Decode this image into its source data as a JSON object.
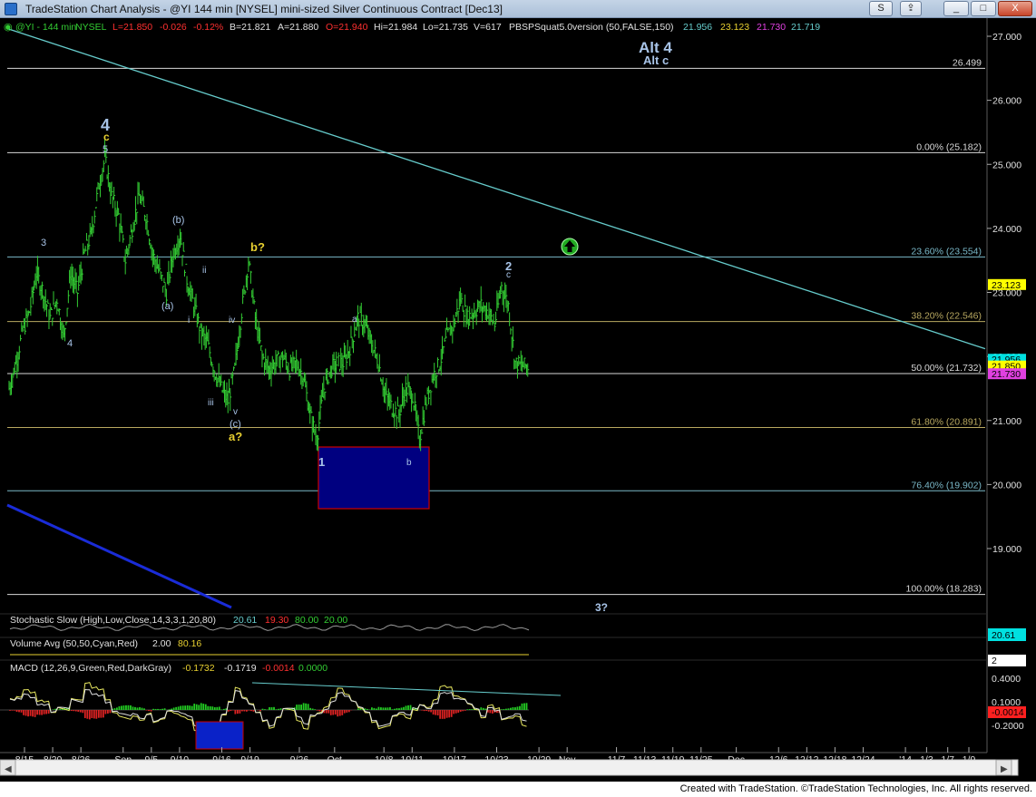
{
  "window": {
    "title": "TradeStation Chart Analysis - @YI 144 min [NYSEL] mini-sized Silver Continuous Contract [Dec13]",
    "buttons": {
      "symbol": "S",
      "minimize": "_",
      "maximize": "□",
      "close": "X"
    }
  },
  "colors": {
    "background": "#000000",
    "price_bars": "#33cc33",
    "trendline": "#66cccc",
    "fib_lines": "#c8c8c8",
    "fib_label": "#c8c8c8",
    "wave_label_white": "#a8c4e8",
    "wave_label_yellow": "#e8d030",
    "last_price_tag": "#ffff00",
    "box_fill": "#000080",
    "box_border": "#cc0000",
    "macd_line": "#e8e860",
    "stoch_line": "#999999"
  },
  "header": {
    "symbol": "@YI - 144 min",
    "exchange": "NYSEL",
    "last": "L=21.850",
    "change": "-0.026",
    "pct_change": "-0.12%",
    "bid": "B=21.821",
    "ask": "A=21.880",
    "open": "O=21.940",
    "high": "Hi=21.984",
    "low": "Lo=21.735",
    "volume": "V=617",
    "indicator_name": "PBSPSquat5.0version (50,FALSE,150)",
    "ind_v1": "21.956",
    "ind_v2": "23.123",
    "ind_v3": "21.730",
    "ind_v4": "21.719"
  },
  "annotations": {
    "alt4": "Alt 4",
    "altc": "Alt c",
    "wave4": "4",
    "wave4_c": "c",
    "wave4_5": "5",
    "w3": "3",
    "w4small": "4",
    "wb_paren": "(b)",
    "wa_paren": "(a)",
    "wii": "ii",
    "wi": "i",
    "wiv": "iv",
    "wiii": "iii",
    "wv": "v",
    "wc_paren": "(c)",
    "a_q": "a?",
    "b_q": "b?",
    "w1": "1",
    "wa": "a",
    "wb": "b",
    "w2": "2",
    "w2c": "c",
    "w3q": "3?"
  },
  "chart_data": {
    "type": "ohlc-bar",
    "symbol": "@YI",
    "interval": "144 min",
    "ylim": [
      18.0,
      27.2
    ],
    "price_axis_ticks": [
      "27.000",
      "26.000",
      "25.000",
      "24.000",
      "23.000",
      "22.000",
      "21.000",
      "20.000",
      "19.000"
    ],
    "price_axis_values": [
      27,
      26,
      25,
      24,
      23,
      22,
      21,
      20,
      19
    ],
    "time_axis_labels": [
      "8/15",
      "8/20",
      "8/26",
      "Sep",
      "9/5",
      "9/10",
      "9/16",
      "9/19",
      "9/26",
      "Oct",
      "10/8",
      "10/11",
      "10/17",
      "10/23",
      "10/29",
      "Nov",
      "11/7",
      "11/13",
      "11/19",
      "11/25",
      "Dec",
      "12/6",
      "12/12",
      "12/18",
      "12/24",
      "'14",
      "1/3",
      "1/7",
      "1/9"
    ],
    "time_axis_index": [
      0,
      4,
      8,
      14,
      18,
      22,
      28,
      32,
      39,
      44,
      51,
      55,
      61,
      67,
      73,
      77,
      84,
      88,
      92,
      96,
      101,
      107,
      111,
      115,
      119,
      125,
      128,
      131,
      134
    ],
    "last_price": "21.850",
    "last_price_value": 21.85,
    "price_tags": [
      {
        "value": 23.123,
        "label": "23.123"
      },
      {
        "value": 21.956,
        "label": "21.956"
      },
      {
        "value": 21.85,
        "label": "21.850"
      },
      {
        "value": 21.73,
        "label": "21.730"
      }
    ],
    "horizontal_lines": [
      {
        "value": 26.499,
        "label": "26.499"
      },
      {
        "value": 25.182,
        "label": "0.00% (25.182)"
      },
      {
        "value": 23.554,
        "label": "23.60% (23.554)"
      },
      {
        "value": 22.546,
        "label": "38.20% (22.546)"
      },
      {
        "value": 21.732,
        "label": "50.00% (21.732)"
      },
      {
        "value": 20.891,
        "label": "61.80% (20.891)"
      },
      {
        "value": 19.902,
        "label": "76.40% (19.902)"
      },
      {
        "value": 18.283,
        "label": "100.00% (18.283)"
      }
    ],
    "trendline": {
      "x": [
        0,
        155
      ],
      "y": [
        27.12,
        22.12
      ]
    },
    "close_series": [
      21.5,
      21.9,
      22.4,
      22.7,
      23.3,
      23.0,
      22.6,
      22.9,
      22.3,
      23.3,
      23.0,
      23.6,
      23.9,
      24.6,
      25.1,
      24.5,
      24.2,
      23.5,
      24.0,
      24.5,
      24.2,
      23.6,
      23.3,
      23.0,
      23.6,
      23.9,
      23.2,
      22.8,
      22.4,
      22.2,
      21.8,
      21.5,
      21.3,
      21.8,
      22.7,
      23.5,
      22.6,
      22.0,
      21.8,
      21.9,
      22.0,
      21.8,
      21.9,
      21.7,
      21.1,
      20.7,
      21.5,
      21.8,
      21.9,
      21.9,
      22.2,
      22.6,
      22.5,
      22.2,
      21.9,
      21.4,
      21.2,
      21.1,
      21.5,
      21.4,
      20.7,
      21.3,
      21.7,
      21.9,
      22.3,
      22.5,
      22.9,
      22.6,
      22.7,
      22.8,
      22.7,
      22.5,
      23.1,
      22.8,
      21.9,
      21.85
    ],
    "indicators": {
      "stochastic": {
        "name": "Stochastic Slow (High,Low,Close,14,3,3,1,20,80)",
        "values": [
          "20.61",
          "19.30",
          "80.00",
          "20.00"
        ],
        "axis_tag": "20.61"
      },
      "volume_avg": {
        "name": "Volume Avg (50,50,Cyan,Red)",
        "values": [
          "2.00",
          "80.16"
        ],
        "axis_tag": "2"
      },
      "macd": {
        "name": "MACD (12,26,9,Green,Red,DarkGray)",
        "values": [
          "-0.1732",
          "-0.1719",
          "-0.0014",
          "0.0000"
        ],
        "axis_ticks": [
          "0.4000",
          "0.1000",
          "-0.2000"
        ],
        "axis_tag": "-0.0014"
      }
    }
  },
  "footer": {
    "text": "Created with TradeStation. ©TradeStation Technologies, Inc. All rights reserved."
  }
}
